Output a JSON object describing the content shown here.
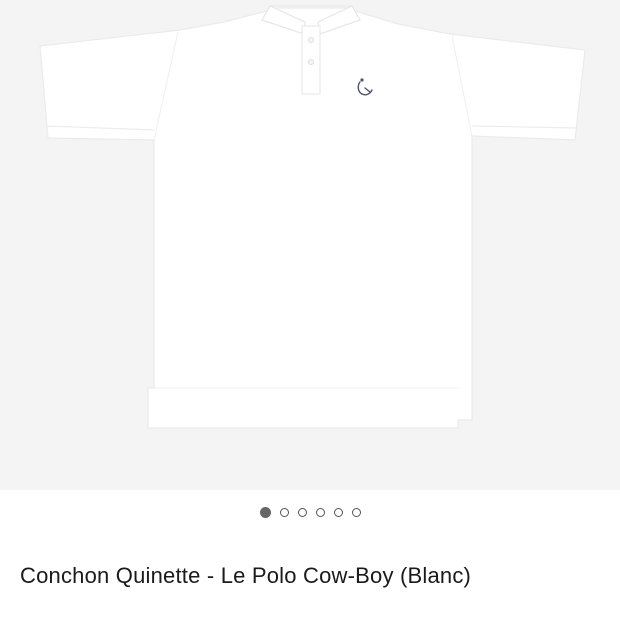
{
  "product": {
    "title": "Conchon Quinette - Le Polo Cow-Boy (Blanc)",
    "image": {
      "icon": "white-polo-shirt",
      "accent_color": "#4a5570",
      "background": "#f4f4f4"
    }
  },
  "gallery": {
    "count": 6,
    "active_index": 0,
    "active_color": "#666666",
    "inactive_color": "#555555"
  }
}
